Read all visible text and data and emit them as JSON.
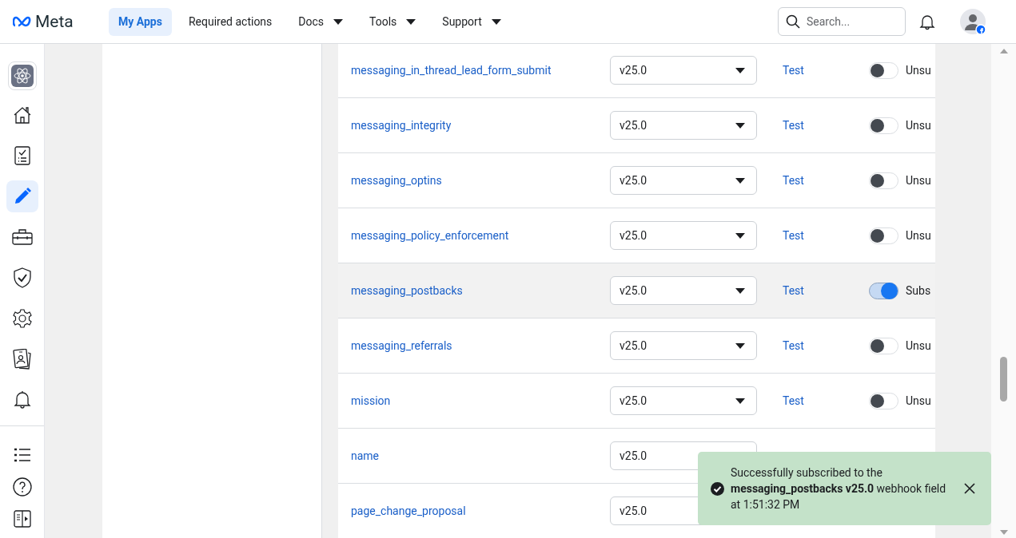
{
  "header": {
    "logo": "Meta",
    "nav": [
      {
        "label": "My Apps",
        "selected": true,
        "dropdown": false
      },
      {
        "label": "Required actions",
        "selected": false,
        "dropdown": false
      },
      {
        "label": "Docs",
        "selected": false,
        "dropdown": true
      },
      {
        "label": "Tools",
        "selected": false,
        "dropdown": true
      },
      {
        "label": "Support",
        "selected": false,
        "dropdown": true
      }
    ],
    "search": {
      "placeholder": "Search..."
    }
  },
  "rail": {
    "items": [
      {
        "kind": "app",
        "selected": false
      },
      {
        "kind": "home",
        "selected": false
      },
      {
        "kind": "checklist",
        "selected": false
      },
      {
        "kind": "pencil",
        "selected": true
      },
      {
        "kind": "briefcase",
        "selected": false
      },
      {
        "kind": "shield",
        "selected": false
      },
      {
        "kind": "gear",
        "selected": false
      },
      {
        "kind": "cards",
        "selected": false
      },
      {
        "kind": "bell",
        "selected": false
      }
    ],
    "bottom": [
      {
        "kind": "list"
      },
      {
        "kind": "help"
      },
      {
        "kind": "panel"
      }
    ]
  },
  "fields": [
    {
      "name": "messaging_in_thread_lead_form_submit",
      "version": "v25.0",
      "test": "Test",
      "on": false,
      "status": "Unsu",
      "highlighted": false
    },
    {
      "name": "messaging_integrity",
      "version": "v25.0",
      "test": "Test",
      "on": false,
      "status": "Unsu",
      "highlighted": false
    },
    {
      "name": "messaging_optins",
      "version": "v25.0",
      "test": "Test",
      "on": false,
      "status": "Unsu",
      "highlighted": false
    },
    {
      "name": "messaging_policy_enforcement",
      "version": "v25.0",
      "test": "Test",
      "on": false,
      "status": "Unsu",
      "highlighted": false
    },
    {
      "name": "messaging_postbacks",
      "version": "v25.0",
      "test": "Test",
      "on": true,
      "status": "Subs",
      "highlighted": true
    },
    {
      "name": "messaging_referrals",
      "version": "v25.0",
      "test": "Test",
      "on": false,
      "status": "Unsu",
      "highlighted": false
    },
    {
      "name": "mission",
      "version": "v25.0",
      "test": "Test",
      "on": false,
      "status": "Unsu",
      "highlighted": false
    },
    {
      "name": "name",
      "version": "v25.0",
      "highlighted": false
    },
    {
      "name": "page_change_proposal",
      "version": "v25.0",
      "highlighted": false
    }
  ],
  "toast": {
    "message": "Successfully subscribed to the **messaging_postbacks v25.0** webhook field at 1:51:32 PM"
  }
}
